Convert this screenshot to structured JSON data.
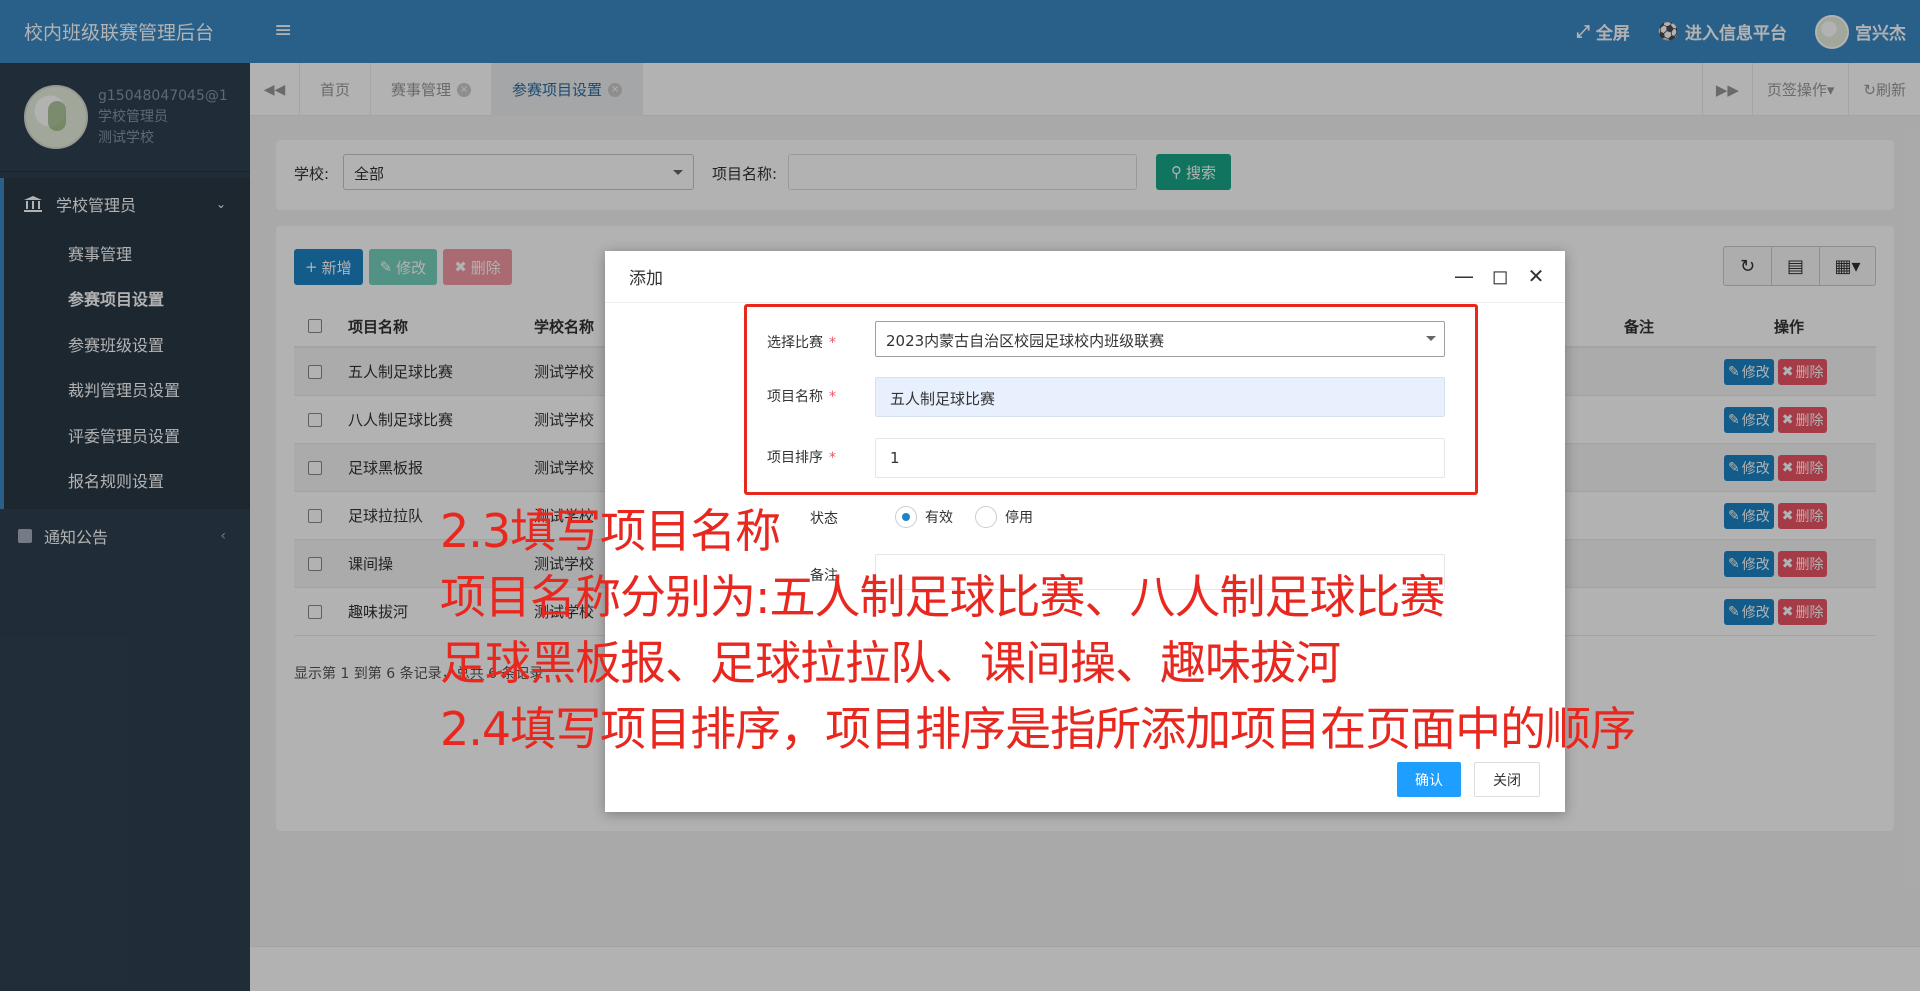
{
  "sidebar": {
    "brand": "校内班级联赛管理后台",
    "profile": {
      "email": "g15048047045@1",
      "role": "学校管理员",
      "school": "测试学校"
    },
    "group": {
      "label": "学校管理员",
      "icon": "bank-icon"
    },
    "items": [
      {
        "label": "赛事管理"
      },
      {
        "label": "参赛项目设置"
      },
      {
        "label": "参赛班级设置"
      },
      {
        "label": "裁判管理员设置"
      },
      {
        "label": "评委管理员设置"
      },
      {
        "label": "报名规则设置"
      }
    ],
    "group2": {
      "label": "通知公告",
      "icon": "notice-icon"
    }
  },
  "topbar": {
    "fullscreen": "全屏",
    "platform": "进入信息平台",
    "username": "宫兴杰"
  },
  "tabs": {
    "items": [
      "首页",
      "赛事管理",
      "参赛项目设置"
    ],
    "tab_ops": "页签操作",
    "refresh": "刷新"
  },
  "search": {
    "school_label": "学校:",
    "school_value": "全部",
    "name_label": "项目名称:",
    "button": "搜索"
  },
  "toolbar": {
    "add": "新增",
    "edit": "修改",
    "delete": "删除"
  },
  "table": {
    "headers": {
      "name": "项目名称",
      "school": "学校名称",
      "remark": "备注",
      "ops": "操作"
    },
    "rows": [
      {
        "name": "五人制足球比赛",
        "school": "测试学校"
      },
      {
        "name": "八人制足球比赛",
        "school": "测试学校"
      },
      {
        "name": "足球黑板报",
        "school": "测试学校"
      },
      {
        "name": "足球拉拉队",
        "school": "测试学校"
      },
      {
        "name": "课间操",
        "school": "测试学校"
      },
      {
        "name": "趣味拔河",
        "school": "测试学校"
      }
    ],
    "op_edit": "修改",
    "op_delete": "删除",
    "footer": "显示第 1 到第 6 条记录，总共 6 条记录"
  },
  "modal": {
    "title": "添加",
    "fields": {
      "match_label": "选择比赛",
      "match_value": "2023内蒙古自治区校园足球校内班级联赛",
      "name_label": "项目名称",
      "name_value": "五人制足球比赛",
      "order_label": "项目排序",
      "order_value": "1",
      "status_label": "状态",
      "status_on": "有效",
      "status_off": "停用",
      "remark_label": "备注"
    },
    "confirm": "确认",
    "close": "关闭"
  },
  "annotation": {
    "lines": [
      "2.3填写项目名称",
      "项目名称分别为:五人制足球比赛、八人制足球比赛",
      "足球黑板报、足球拉拉队、课间操、趣味拔河",
      "2.4填写项目排序，项目排序是指所添加项目在页面中的顺序"
    ]
  },
  "colors": {
    "primary": "#3a8ac4",
    "sidebar": "#2f4050",
    "annotation_red": "#e8271f",
    "success": "#18a689",
    "danger": "#ed5565"
  }
}
